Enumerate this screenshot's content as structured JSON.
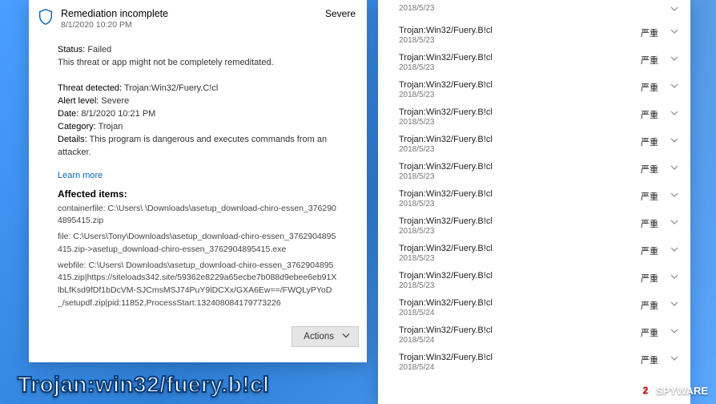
{
  "left": {
    "title": "Remediation incomplete",
    "timestamp": "8/1/2020 10:20 PM",
    "severity": "Severe",
    "status_label": "Status:",
    "status_value": "Failed",
    "status_desc": "This threat or app might not be completely remeditated.",
    "threat_label": "Threat detected:",
    "threat_value": "Trojan:Win32/Fuery.C!cl",
    "alert_label": "Alert level:",
    "alert_value": "Severe",
    "date_label": "Date:",
    "date_value": "8/1/2020 10:21 PM",
    "category_label": "Category:",
    "category_value": "Trojan",
    "details_label": "Details:",
    "details_value": "This program is dangerous and executes commands from an attacker.",
    "learn_more": "Learn more",
    "affected_title": "Affected items:",
    "affected_items": [
      "containerfile: C:\\Users\\        \\Downloads\\asetup_download-chiro-essen_3762904895415.zip",
      "file: C:\\Users\\Tony\\Downloads\\asetup_download-chiro-essen_3762904895415.zip->asetup_download-chiro-essen_3762904895415.exe",
      "webfile: C:\\Users\\        Downloads\\asetup_download-chiro-essen_3762904895415.zip|https://siteloads342.site/59362e8229a65ecbe7b088d9ebee6eb91XlbLfKsd9fDf1bDcVM-SJCmsMSJ74PuY9lDCXx/GXA6Ew==/FWQLyPYoD_/setupdf.zip|pid:11852,ProcessStart:132408084179773226"
    ],
    "actions_label": "Actions"
  },
  "right": {
    "first_date": "2018/5/23",
    "threats": [
      {
        "name": "Trojan:Win32/Fuery.B!cl",
        "date": "2018/5/23",
        "sev": "严重"
      },
      {
        "name": "Trojan:Win32/Fuery.B!cl",
        "date": "2018/5/23",
        "sev": "严重"
      },
      {
        "name": "Trojan:Win32/Fuery.B!cl",
        "date": "2018/5/23",
        "sev": "严重"
      },
      {
        "name": "Trojan:Win32/Fuery.B!cl",
        "date": "2018/5/23",
        "sev": "严重"
      },
      {
        "name": "Trojan:Win32/Fuery.B!cl",
        "date": "2018/5/23",
        "sev": "严重"
      },
      {
        "name": "Trojan:Win32/Fuery.B!cl",
        "date": "2018/5/23",
        "sev": "严重"
      },
      {
        "name": "Trojan:Win32/Fuery.B!cl",
        "date": "2018/5/23",
        "sev": "严重"
      },
      {
        "name": "Trojan:Win32/Fuery.B!cl",
        "date": "2018/5/23",
        "sev": "严重"
      },
      {
        "name": "Trojan:Win32/Fuery.B!cl",
        "date": "2018/5/23",
        "sev": "严重"
      },
      {
        "name": "Trojan:Win32/Fuery.B!cl",
        "date": "2018/5/23",
        "sev": "严重"
      },
      {
        "name": "Trojan:Win32/Fuery.B!cl",
        "date": "2018/5/24",
        "sev": "严重"
      },
      {
        "name": "Trojan:Win32/Fuery.B!cl",
        "date": "2018/5/24",
        "sev": "严重"
      },
      {
        "name": "Trojan:Win32/Fuery.B!cl",
        "date": "2018/5/24",
        "sev": "严重"
      }
    ]
  },
  "caption": "Trojan:win32/fuery.b!cl",
  "logo": {
    "num": "2",
    "text": "SPYWARE"
  }
}
